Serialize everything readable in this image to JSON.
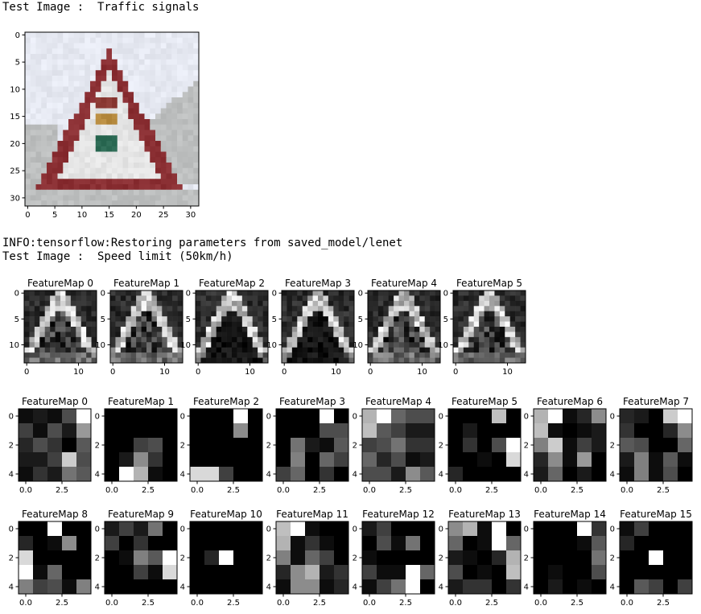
{
  "output": {
    "line1": "Test Image :  Traffic signals",
    "line2": "INFO:tensorflow:Restoring parameters from saved_model/lenet",
    "line3": "Test Image :  Speed limit (50km/h)"
  },
  "test_image": {
    "xticks": [
      "0",
      "5",
      "10",
      "15",
      "20",
      "25",
      "30"
    ],
    "yticks": [
      "0",
      "5",
      "10",
      "15",
      "20",
      "25",
      "30"
    ],
    "colors": {
      "sky": "#e6e9f2",
      "gray": "#bdbfbf",
      "border": "#8a2f33",
      "inner": "#e5e5e5",
      "light_red": "#8c3b35",
      "light_yellow": "#b68a3e",
      "light_green": "#2d6b55"
    }
  },
  "conv1": {
    "titles": [
      "FeatureMap 0",
      "FeatureMap 1",
      "FeatureMap 2",
      "FeatureMap 3",
      "FeatureMap 4",
      "FeatureMap 5"
    ],
    "xticks": [
      "0",
      "10"
    ],
    "yticks": [
      "0",
      "5",
      "10"
    ]
  },
  "conv2_row1": {
    "titles": [
      "FeatureMap 0",
      "FeatureMap 1",
      "FeatureMap 2",
      "FeatureMap 3",
      "FeatureMap 4",
      "FeatureMap 5",
      "FeatureMap 6",
      "FeatureMap 7"
    ],
    "xticks": [
      "0.0",
      "2.5"
    ],
    "yticks": [
      "0",
      "2",
      "4"
    ],
    "cells": [
      [
        [
          0.05,
          0.1,
          0.05,
          0.3,
          1.0
        ],
        [
          0.25,
          0.05,
          0.3,
          0.1,
          0.6
        ],
        [
          0.15,
          0.3,
          0.2,
          0.0,
          0.35
        ],
        [
          0.1,
          0.1,
          0.25,
          0.8,
          0.3
        ],
        [
          0.05,
          0.2,
          0.1,
          0.45,
          0.35
        ]
      ],
      [
        [
          0,
          0,
          0,
          0,
          0
        ],
        [
          0,
          0,
          0,
          0,
          0
        ],
        [
          0,
          0,
          0.25,
          0.3,
          0
        ],
        [
          0,
          0.1,
          0.55,
          0.2,
          0
        ],
        [
          0,
          1.0,
          0.7,
          0.05,
          0
        ]
      ],
      [
        [
          0,
          0,
          0,
          1.0,
          0
        ],
        [
          0,
          0,
          0,
          0.55,
          0
        ],
        [
          0,
          0,
          0,
          0,
          0
        ],
        [
          0,
          0,
          0,
          0,
          0
        ],
        [
          0.85,
          0.85,
          0.25,
          0,
          0
        ]
      ],
      [
        [
          0,
          0,
          0,
          1.0,
          0
        ],
        [
          0,
          0,
          0,
          0.3,
          0.3
        ],
        [
          0,
          0.45,
          0.1,
          0.05,
          0.35
        ],
        [
          0,
          0.5,
          0,
          0.4,
          0.25
        ],
        [
          0.25,
          0.4,
          0,
          0.2,
          0
        ]
      ],
      [
        [
          0.7,
          1.0,
          0.4,
          0.3,
          0.3
        ],
        [
          0.75,
          0.35,
          0.25,
          0.1,
          0.1
        ],
        [
          0.25,
          0.3,
          0.45,
          0.2,
          0.2
        ],
        [
          0.4,
          0.15,
          0.3,
          0.05,
          0.1
        ],
        [
          0.3,
          0.3,
          0.1,
          0.55,
          0.35
        ]
      ],
      [
        [
          0,
          0,
          0,
          0.75,
          0
        ],
        [
          0,
          0.1,
          0,
          0,
          0
        ],
        [
          0,
          0.2,
          0,
          0.3,
          1.0
        ],
        [
          0,
          0,
          0.05,
          0,
          0.85
        ],
        [
          0.15,
          0,
          0,
          0,
          0
        ]
      ],
      [
        [
          0.7,
          1.0,
          0.05,
          0.15,
          0.55
        ],
        [
          0.75,
          0.05,
          0,
          0.05,
          0.1
        ],
        [
          0.5,
          0.8,
          0.05,
          0.25,
          0.1
        ],
        [
          0.15,
          0.55,
          0.05,
          0.6,
          0
        ],
        [
          0.1,
          0.4,
          0,
          0.1,
          0
        ]
      ],
      [
        [
          0.15,
          0.1,
          0,
          0.8,
          1.0
        ],
        [
          0.2,
          0,
          0,
          0.15,
          0.55
        ],
        [
          0.35,
          0.3,
          0,
          0,
          0.4
        ],
        [
          0.1,
          0.5,
          0.05,
          0.35,
          0.05
        ],
        [
          0.05,
          0.5,
          0.05,
          0.3,
          0
        ]
      ]
    ]
  },
  "conv2_row2": {
    "titles": [
      "FeatureMap 8",
      "FeatureMap 9",
      "FeatureMap 10",
      "FeatureMap 11",
      "FeatureMap 12",
      "FeatureMap 13",
      "FeatureMap 14",
      "FeatureMap 15"
    ],
    "xticks": [
      "0.0",
      "2.5"
    ],
    "yticks": [
      "0",
      "2",
      "4"
    ],
    "cells": [
      [
        [
          0,
          0,
          1.0,
          0,
          0
        ],
        [
          0.15,
          0,
          0.05,
          0.55,
          0
        ],
        [
          0.85,
          0,
          0,
          0,
          0
        ],
        [
          1.0,
          0.05,
          0.4,
          0,
          0
        ],
        [
          0.5,
          0.25,
          0.3,
          0.05,
          0.5
        ]
      ],
      [
        [
          0.1,
          0.25,
          0.1,
          0.45,
          0
        ],
        [
          0.25,
          0,
          0.2,
          0,
          0
        ],
        [
          0,
          0.05,
          0.5,
          0.35,
          1.0
        ],
        [
          0,
          0,
          0.25,
          0.05,
          0.85
        ],
        [
          0,
          0,
          0,
          0,
          0
        ]
      ],
      [
        [
          0,
          0,
          0,
          0,
          0
        ],
        [
          0,
          0,
          0,
          0,
          0
        ],
        [
          0,
          0.15,
          1.0,
          0,
          0
        ],
        [
          0,
          0,
          0,
          0,
          0
        ],
        [
          0,
          0,
          0,
          0,
          0
        ]
      ],
      [
        [
          0.75,
          1.0,
          0.05,
          0,
          0
        ],
        [
          0.7,
          0.05,
          0.2,
          0.05,
          0
        ],
        [
          0.5,
          0.05,
          0.4,
          0.25,
          0
        ],
        [
          0.15,
          0.55,
          0.7,
          0.1,
          0.2
        ],
        [
          0.05,
          0.55,
          0.55,
          0.05,
          0.15
        ]
      ],
      [
        [
          0.1,
          0.25,
          0,
          0,
          0
        ],
        [
          0,
          0.3,
          0.05,
          0.45,
          0
        ],
        [
          0.05,
          0,
          0,
          0,
          0
        ],
        [
          0.25,
          0.05,
          0.05,
          1.0,
          0.4
        ],
        [
          0.05,
          0.25,
          0.45,
          1.0,
          0
        ]
      ],
      [
        [
          0.55,
          0.7,
          0.05,
          1.0,
          0
        ],
        [
          0.4,
          0,
          0.05,
          1.0,
          0.4
        ],
        [
          0.1,
          0.05,
          0,
          0.15,
          0.7
        ],
        [
          0.3,
          0,
          0.05,
          0,
          0.75
        ],
        [
          0.1,
          0.2,
          0.2,
          0,
          0.2
        ]
      ],
      [
        [
          0,
          0,
          0,
          1.0,
          0.2
        ],
        [
          0,
          0,
          0,
          0.05,
          0.35
        ],
        [
          0,
          0,
          0,
          0,
          0.45
        ],
        [
          0,
          0.05,
          0,
          0,
          0.3
        ],
        [
          0,
          0.1,
          0,
          0.05,
          0
        ]
      ],
      [
        [
          0.05,
          0.25,
          0,
          0,
          0
        ],
        [
          0.15,
          0,
          0,
          0,
          0
        ],
        [
          0,
          0,
          1.0,
          0,
          0
        ],
        [
          0,
          0,
          0,
          0,
          0
        ],
        [
          0,
          0.35,
          0.25,
          0,
          0.25
        ]
      ]
    ]
  }
}
